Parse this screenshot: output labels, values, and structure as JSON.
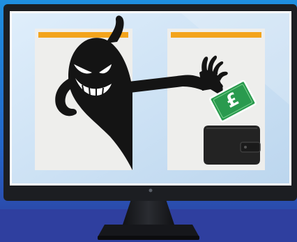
{
  "illustration": {
    "banknote_symbol": "£",
    "icons": [
      "monitor-icon",
      "thief-silhouette-icon",
      "banknote-icon",
      "wallet-icon"
    ],
    "colors": {
      "background": "#2b6ccf",
      "desk": "#2f3fa0",
      "monitor_bezel": "#1c1e22",
      "screen": "#cfe3f5",
      "page": "#eeeeec",
      "page_header": "#f3a41c",
      "silhouette": "#141414",
      "banknote": "#2a9a4e",
      "wallet": "#232323"
    }
  }
}
